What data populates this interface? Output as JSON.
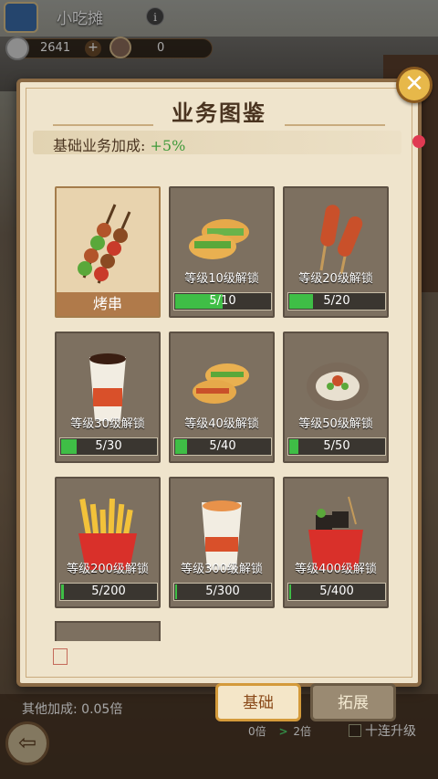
{
  "hud": {
    "stall_title": "小吃摊",
    "info_icon": "i",
    "resource_1": "2641",
    "plus": "+",
    "resource_2": "0"
  },
  "modal": {
    "title": "业务图鉴",
    "bonus_label": "基础业务加成: ",
    "bonus_value": "+5%",
    "close_glyph": "✕",
    "seal_text": "鑒"
  },
  "cards": [
    {
      "id": "kebab",
      "unlocked": true,
      "name": "烤串",
      "art": "kebab-skewers-icon"
    },
    {
      "id": "sandwich",
      "unlocked": false,
      "lock_text": "等级10级解锁",
      "progress_text": "5/10",
      "progress": 0.5,
      "art": "sandwich-icon"
    },
    {
      "id": "sausage",
      "unlocked": false,
      "lock_text": "等级20级解锁",
      "progress_text": "5/20",
      "progress": 0.25,
      "art": "sausage-stick-icon"
    },
    {
      "id": "cola",
      "unlocked": false,
      "lock_text": "等级30级解锁",
      "progress_text": "5/30",
      "progress": 0.1667,
      "art": "cola-cup-icon"
    },
    {
      "id": "wrap",
      "unlocked": false,
      "lock_text": "等级40级解锁",
      "progress_text": "5/40",
      "progress": 0.125,
      "art": "wrap-icon"
    },
    {
      "id": "oyster",
      "unlocked": false,
      "lock_text": "等级50级解锁",
      "progress_text": "5/50",
      "progress": 0.1,
      "art": "oyster-icon"
    },
    {
      "id": "fries",
      "unlocked": false,
      "lock_text": "等级200级解锁",
      "progress_text": "5/200",
      "progress": 0.025,
      "art": "fries-icon"
    },
    {
      "id": "tea",
      "unlocked": false,
      "lock_text": "等级300级解锁",
      "progress_text": "5/300",
      "progress": 0.0167,
      "art": "milk-tea-icon"
    },
    {
      "id": "stinky_tofu",
      "unlocked": false,
      "lock_text": "等级400级解锁",
      "progress_text": "5/400",
      "progress": 0.0125,
      "art": "stinky-tofu-icon"
    }
  ],
  "tabs": {
    "basic": "基础",
    "expand": "拓展"
  },
  "bottom": {
    "other_bonus": "其他加成: 0.05倍",
    "mult_from": "0倍",
    "mult_arrow": ">",
    "mult_to": "2倍",
    "ten_upgrade": "十连升级",
    "back_glyph": "⇦"
  },
  "colors": {
    "progress_fill": "#3fbe46",
    "bonus_value": "#3f9a3a",
    "close_button": "#e7b84a"
  }
}
